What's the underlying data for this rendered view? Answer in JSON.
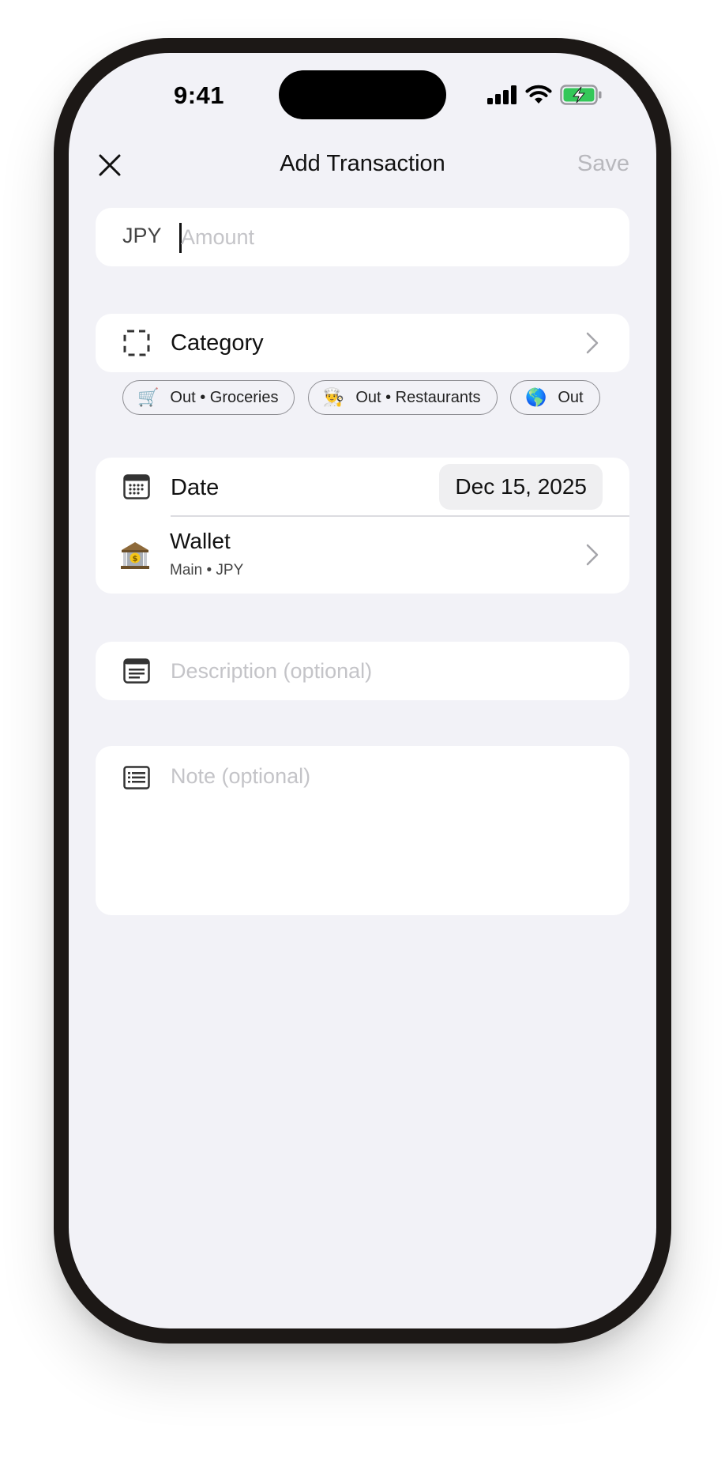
{
  "status_bar": {
    "time": "9:41"
  },
  "nav": {
    "title": "Add Transaction",
    "save_label": "Save",
    "close_icon": "close-icon"
  },
  "amount": {
    "currency": "JPY",
    "placeholder": "Amount",
    "value": ""
  },
  "category": {
    "label": "Category",
    "icon": "dashed-square-icon"
  },
  "quick_categories": [
    {
      "emoji": "🛒",
      "label": "Out • Groceries"
    },
    {
      "emoji": "👨‍🍳",
      "label": "Out • Restaurants"
    },
    {
      "emoji": "🌎",
      "label": "Out"
    }
  ],
  "date": {
    "label": "Date",
    "value": "Dec 15, 2025",
    "icon": "calendar-icon"
  },
  "wallet": {
    "name": "Wallet",
    "subtitle": "Main • JPY",
    "icon": "bank-icon"
  },
  "description": {
    "placeholder": "Description (optional)",
    "icon": "card-text-icon"
  },
  "note": {
    "placeholder": "Note (optional)",
    "icon": "list-text-icon"
  },
  "colors": {
    "background": "#f2f2f7",
    "card": "#ffffff",
    "placeholder": "#c4c4c8",
    "disabled": "#b8b8bd",
    "battery_green": "#34c759"
  }
}
